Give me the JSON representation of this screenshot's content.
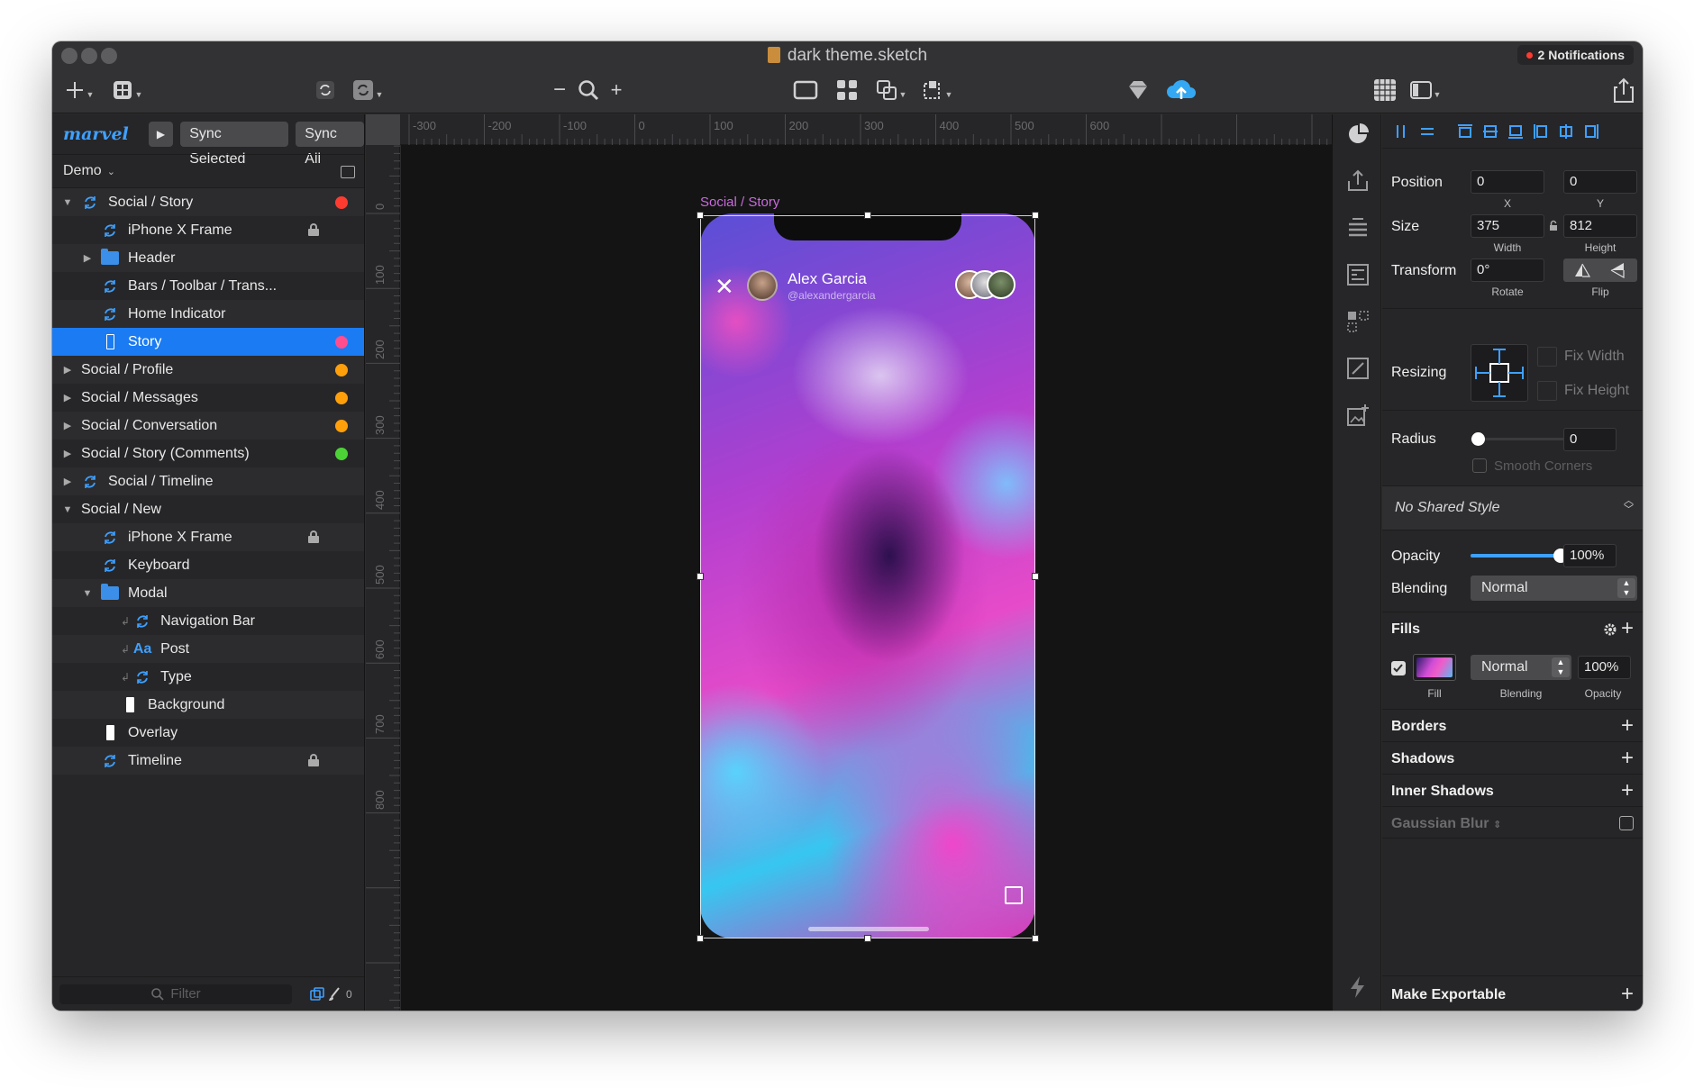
{
  "window": {
    "title": "dark theme.sketch",
    "notifications": "2 Notifications"
  },
  "plugin_bar": {
    "logo": "marvel",
    "sync_selected": "Sync Selected",
    "sync_all": "Sync All"
  },
  "page": {
    "name": "Demo"
  },
  "layers": [
    {
      "label": "Social / Story",
      "indent": 0,
      "disc": "open",
      "icon": "symbol-icon",
      "dot": "#ff3b30"
    },
    {
      "label": "iPhone X Frame",
      "indent": 1,
      "disc": "",
      "icon": "symbol-icon",
      "lock": true
    },
    {
      "label": "Header",
      "indent": 1,
      "disc": "closed",
      "icon": "folder-icon"
    },
    {
      "label": "Bars / Toolbar / Trans...",
      "indent": 1,
      "disc": "",
      "icon": "symbol-icon"
    },
    {
      "label": "Home Indicator",
      "indent": 1,
      "disc": "",
      "icon": "symbol-icon"
    },
    {
      "label": "Story",
      "indent": 1,
      "disc": "",
      "icon": "rectangle-icon",
      "dot": "#ff4d8d",
      "selected": true
    },
    {
      "label": "Social / Profile",
      "indent": 0,
      "disc": "closed",
      "icon": "",
      "dot": "#ff9f0a"
    },
    {
      "label": "Social / Messages",
      "indent": 0,
      "disc": "closed",
      "icon": "",
      "dot": "#ff9f0a"
    },
    {
      "label": "Social / Conversation",
      "indent": 0,
      "disc": "closed",
      "icon": "",
      "dot": "#ff9f0a"
    },
    {
      "label": "Social / Story (Comments)",
      "indent": 0,
      "disc": "closed",
      "icon": "",
      "dot": "#4cd137"
    },
    {
      "label": "Social / Timeline",
      "indent": 0,
      "disc": "closed",
      "icon": "symbol-icon"
    },
    {
      "label": "Social / New",
      "indent": 0,
      "disc": "open",
      "icon": ""
    },
    {
      "label": "iPhone X Frame",
      "indent": 1,
      "disc": "",
      "icon": "symbol-icon",
      "lock": true
    },
    {
      "label": "Keyboard",
      "indent": 1,
      "disc": "",
      "icon": "symbol-icon"
    },
    {
      "label": "Modal",
      "indent": 1,
      "disc": "open",
      "icon": "folder-icon"
    },
    {
      "label": "Navigation Bar",
      "indent": 2,
      "disc": "",
      "icon": "symbol-icon",
      "masked": true
    },
    {
      "label": "Post",
      "indent": 2,
      "disc": "",
      "icon": "text-icon",
      "masked": true
    },
    {
      "label": "Type",
      "indent": 2,
      "disc": "",
      "icon": "symbol-icon",
      "masked": true
    },
    {
      "label": "Background",
      "indent": 2,
      "disc": "",
      "icon": "rectangle-fill-icon"
    },
    {
      "label": "Overlay",
      "indent": 1,
      "disc": "",
      "icon": "rectangle-fill-icon"
    },
    {
      "label": "Timeline",
      "indent": 1,
      "disc": "",
      "icon": "symbol-icon",
      "lock": true
    }
  ],
  "filter": {
    "placeholder": "Filter",
    "count": "0"
  },
  "ruler": {
    "h_ticks": [
      "-300",
      "-200",
      "-100",
      "0",
      "100",
      "200",
      "300",
      "400",
      "500",
      "600"
    ],
    "v_ticks": [
      "0",
      "100",
      "200",
      "300",
      "400",
      "500",
      "600",
      "700",
      "800"
    ]
  },
  "artboard": {
    "title": "Social / Story",
    "story_user": "Alex Garcia",
    "story_handle": "@alexandergarcia"
  },
  "inspector": {
    "position_label": "Position",
    "x": "0",
    "y": "0",
    "x_label": "X",
    "y_label": "Y",
    "size_label": "Size",
    "width": "375",
    "height": "812",
    "width_label": "Width",
    "height_label": "Height",
    "transform_label": "Transform",
    "rotate": "0°",
    "rotate_label": "Rotate",
    "flip_label": "Flip",
    "resizing_label": "Resizing",
    "fix_width": "Fix Width",
    "fix_height": "Fix Height",
    "radius_label": "Radius",
    "radius": "0",
    "smooth_corners": "Smooth Corners",
    "shared_style": "No Shared Style",
    "opacity_label": "Opacity",
    "opacity": "100%",
    "opacity_level": 1.0,
    "blending_label": "Blending",
    "blending": "Normal",
    "fills_title": "Fills",
    "fill_blending": "Normal",
    "fill_opacity": "100%",
    "fill_sub": "Fill",
    "fill_blending_sub": "Blending",
    "fill_opacity_sub": "Opacity",
    "borders": "Borders",
    "shadows": "Shadows",
    "inner_shadows": "Inner Shadows",
    "gaussian_blur": "Gaussian Blur",
    "make_exportable": "Make Exportable"
  },
  "colors": {
    "accent": "#1a7bf2",
    "artboard_title": "#c86bdc"
  }
}
